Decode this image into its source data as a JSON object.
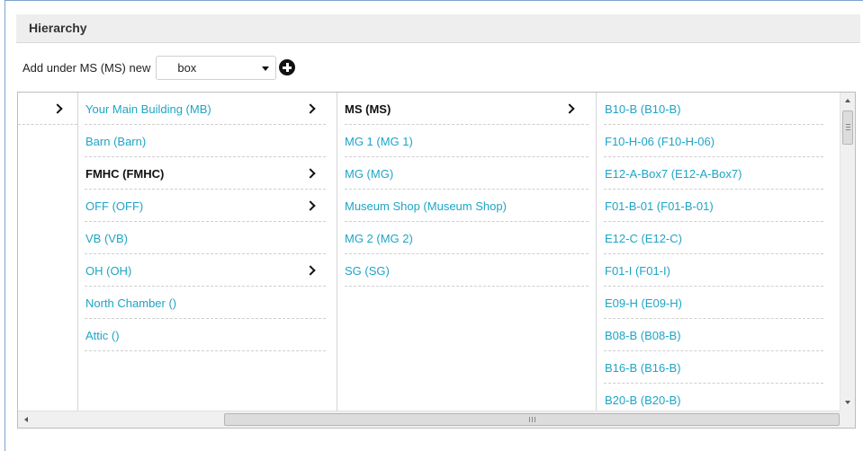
{
  "panel": {
    "title": "Hierarchy"
  },
  "add_row": {
    "label": "Add under MS (MS) new",
    "select_value": "box"
  },
  "columns": [
    {
      "items": [
        {
          "label": "",
          "bold": false,
          "has_children": true
        }
      ]
    },
    {
      "items": [
        {
          "label": "Your Main Building (MB)",
          "bold": false,
          "has_children": true
        },
        {
          "label": "Barn (Barn)",
          "bold": false,
          "has_children": false
        },
        {
          "label": "FMHC (FMHC)",
          "bold": true,
          "has_children": true
        },
        {
          "label": "OFF (OFF)",
          "bold": false,
          "has_children": true
        },
        {
          "label": "VB (VB)",
          "bold": false,
          "has_children": false
        },
        {
          "label": "OH (OH)",
          "bold": false,
          "has_children": true
        },
        {
          "label": "North Chamber ()",
          "bold": false,
          "has_children": false
        },
        {
          "label": "Attic ()",
          "bold": false,
          "has_children": false
        }
      ]
    },
    {
      "items": [
        {
          "label": "MS (MS)",
          "bold": true,
          "has_children": true
        },
        {
          "label": "MG 1 (MG 1)",
          "bold": false,
          "has_children": false
        },
        {
          "label": "MG (MG)",
          "bold": false,
          "has_children": false
        },
        {
          "label": "Museum Shop (Museum Shop)",
          "bold": false,
          "has_children": false
        },
        {
          "label": "MG 2 (MG 2)",
          "bold": false,
          "has_children": false
        },
        {
          "label": "SG (SG)",
          "bold": false,
          "has_children": false
        }
      ]
    },
    {
      "items": [
        {
          "label": "B10-B (B10-B)",
          "bold": false,
          "has_children": false
        },
        {
          "label": "F10-H-06 (F10-H-06)",
          "bold": false,
          "has_children": false
        },
        {
          "label": "E12-A-Box7 (E12-A-Box7)",
          "bold": false,
          "has_children": false
        },
        {
          "label": "F01-B-01 (F01-B-01)",
          "bold": false,
          "has_children": false
        },
        {
          "label": "E12-C (E12-C)",
          "bold": false,
          "has_children": false
        },
        {
          "label": "F01-I (F01-I)",
          "bold": false,
          "has_children": false
        },
        {
          "label": "E09-H (E09-H)",
          "bold": false,
          "has_children": false
        },
        {
          "label": "B08-B (B08-B)",
          "bold": false,
          "has_children": false
        },
        {
          "label": "B16-B (B16-B)",
          "bold": false,
          "has_children": false
        },
        {
          "label": "B20-B (B20-B)",
          "bold": false,
          "has_children": false
        }
      ]
    }
  ],
  "colors": {
    "link": "#1ea5c6",
    "selected": "#111111",
    "header_bg": "#eeeeee"
  },
  "icons": {
    "add": "plus-circle-icon",
    "expand": "chevron-right-icon"
  }
}
